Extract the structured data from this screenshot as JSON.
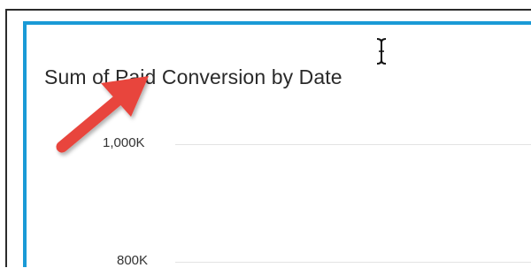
{
  "visual": {
    "title": "Sum of Paid Conversion by Date",
    "accent_color": "#1a9ad6"
  },
  "chart_data": {
    "type": "line",
    "title": "Sum of Paid Conversion by Date",
    "xlabel": "",
    "ylabel": "",
    "y_tick_labels": [
      "1,000K",
      "800K"
    ],
    "grid": true
  },
  "annotations": {
    "arrow_color": "#e8453c",
    "cursor": "text-cursor-icon"
  }
}
